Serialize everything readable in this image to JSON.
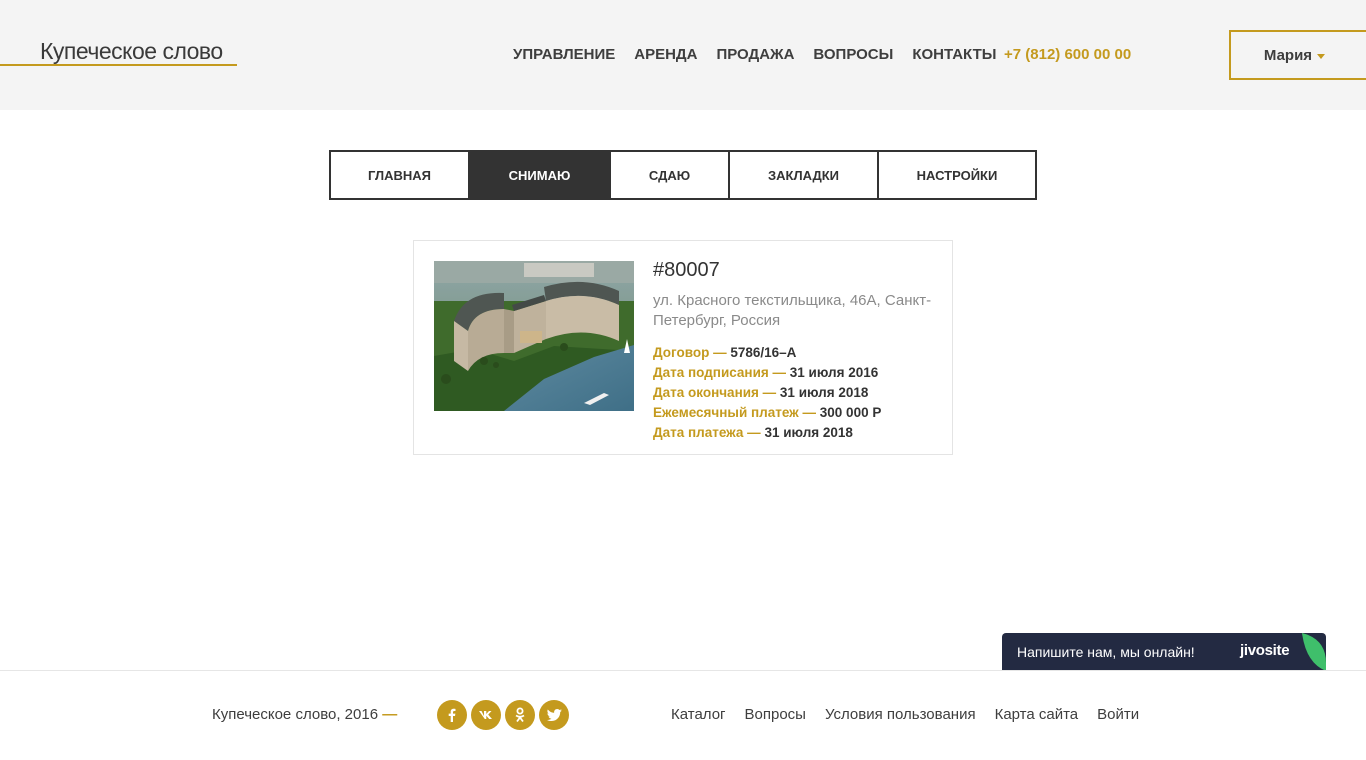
{
  "header": {
    "logo": "Купеческое слово",
    "nav": [
      "Управление",
      "Аренда",
      "Продажа",
      "Вопросы",
      "Контакты"
    ],
    "phone": "+7 (812) 600 00 00",
    "user_name": "Мария"
  },
  "tabs": [
    {
      "label": "Главная",
      "active": false
    },
    {
      "label": "Снимаю",
      "active": true
    },
    {
      "label": "Сдаю",
      "active": false
    },
    {
      "label": "Закладки",
      "active": false
    },
    {
      "label": "Настройки",
      "active": false
    }
  ],
  "card": {
    "id": "#80007",
    "address": "ул. Красного текстильщика, 46А, Санкт-Петербург, Россия",
    "rows": [
      {
        "label": "Договор —",
        "value": "5786/16–А"
      },
      {
        "label": "Дата подписания —",
        "value": "31 июля 2016"
      },
      {
        "label": "Дата окончания —",
        "value": "31 июля 2018"
      },
      {
        "label": "Ежемесячный платеж —",
        "value": "300 000 Р"
      },
      {
        "label": "Дата платежа —",
        "value": "31 июля 2018"
      }
    ]
  },
  "chat": {
    "text": "Напишите нам, мы онлайн!",
    "brand": "jivosite"
  },
  "footer": {
    "copyright": "Купеческое слово, 2016",
    "dash": "—",
    "socials": [
      {
        "icon": "facebook-icon",
        "glyph": "f"
      },
      {
        "icon": "vk-icon",
        "glyph": "vk"
      },
      {
        "icon": "odnoklassniki-icon",
        "glyph": "ok"
      },
      {
        "icon": "twitter-icon",
        "glyph": "t"
      }
    ],
    "links": [
      "Каталог",
      "Вопросы",
      "Условия пользования",
      "Карта сайта",
      "Войти"
    ]
  },
  "colors": {
    "accent": "#c49a1e",
    "dark": "#333333",
    "header_bg": "#f4f4f4",
    "chat_bg": "#232a42"
  }
}
